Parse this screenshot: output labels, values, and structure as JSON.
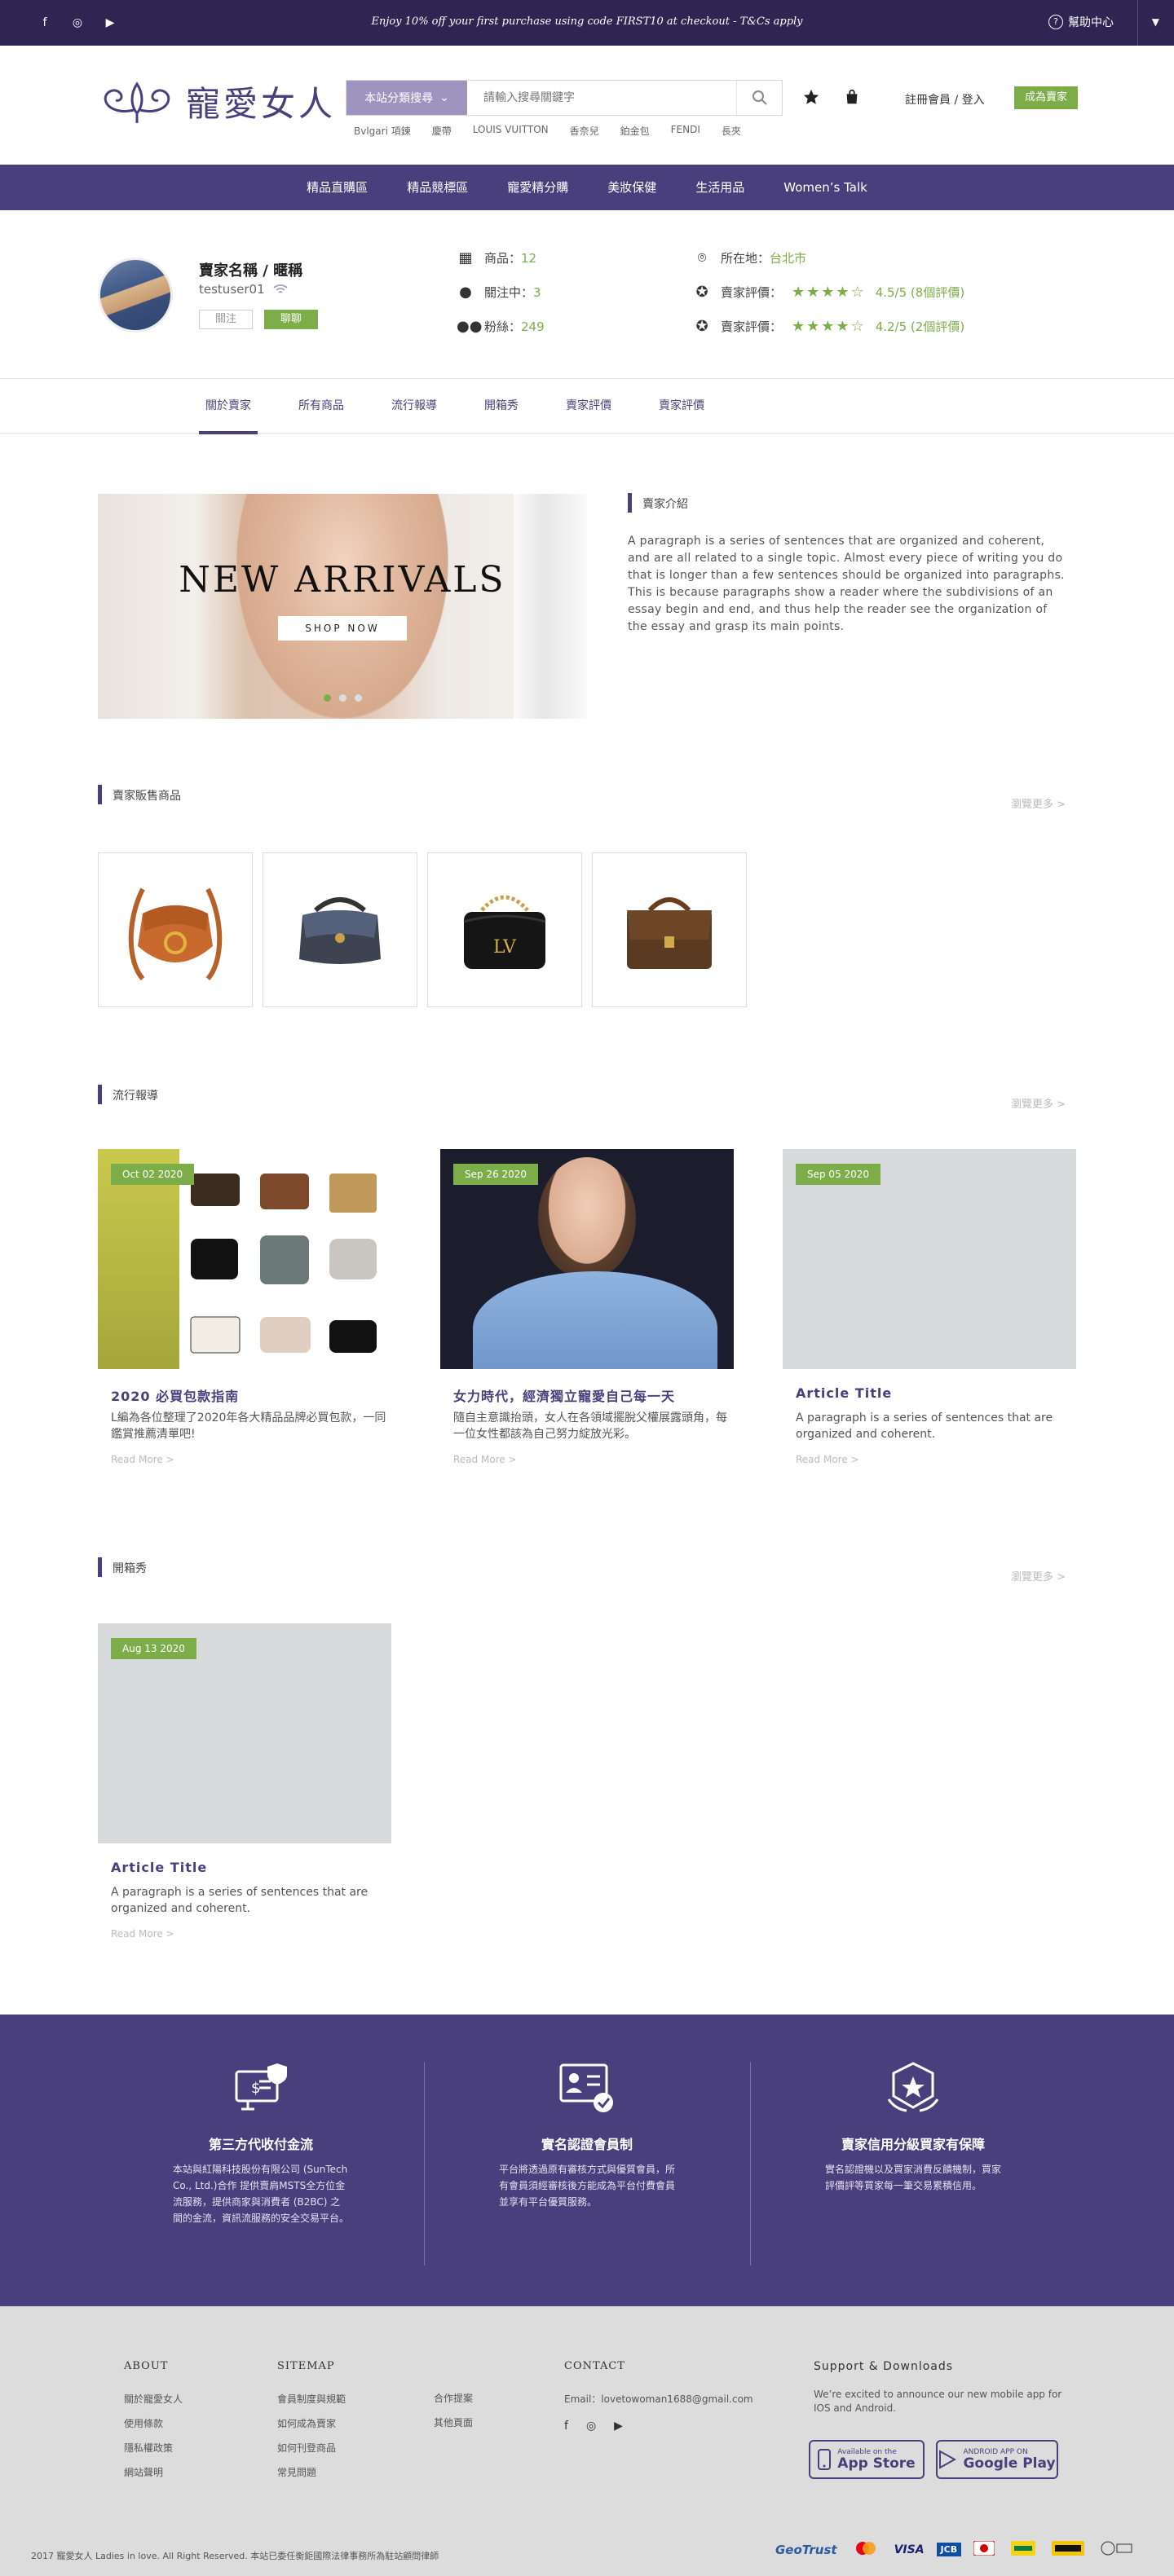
{
  "topbar": {
    "social": [
      "f",
      "◎",
      "▶"
    ],
    "promo": "Enjoy 10% off your first purchase using code FIRST10 at checkout - T&Cs apply",
    "help": "幫助中心"
  },
  "header": {
    "logo_text": "寵愛女人",
    "search_category": "本站分類搜尋",
    "search_placeholder": "請輸入搜尋關鍵字",
    "hot_keywords": [
      "Bvlgari 項鍊",
      "慶帶",
      "LOUIS VUITTON",
      "香奈兒",
      "鉑金包",
      "FENDI",
      "長夾"
    ],
    "login": "註冊會員 / 登入",
    "become_seller": "成為賣家"
  },
  "nav": [
    "精品直購區",
    "精品競標區",
    "寵愛精分購",
    "美妝保健",
    "生活用品",
    "Women’s Talk"
  ],
  "seller": {
    "name": "賣家名稱 / 暱稱",
    "username": "testuser01",
    "follow": "關注",
    "chat": "聊聊",
    "products_label": "商品：",
    "products_value": "12",
    "following_label": "關注中：",
    "following_value": "3",
    "fans_label": "粉絲：",
    "fans_value": "249",
    "location_label": "所在地：",
    "location_value": "台北市",
    "rating1_label": "賣家評價：",
    "rating1_value": "4.5/5 (8個評價)",
    "rating2_label": "賣家評價：",
    "rating2_value": "4.2/5 (2個評價)"
  },
  "tabs": [
    "關於賣家",
    "所有商品",
    "流行報導",
    "開箱秀",
    "賣家評價",
    "賣家評價"
  ],
  "banner": {
    "headline": "NEW ARRIVALS",
    "button": "SHOP NOW"
  },
  "intro": {
    "title": "賣家介紹",
    "text": "A paragraph is a series of sentences that are organized and coherent, and are all related to a single topic. Almost every piece of writing you do that is longer than a few sentences should be organized into paragraphs. This is because paragraphs show a reader where the subdivisions of an essay begin and end, and thus help the reader see the organization of the essay and grasp its main points."
  },
  "products": {
    "title": "賣家販售商品",
    "more": "瀏覽更多 >"
  },
  "news": {
    "title": "流行報導",
    "more": "瀏覽更多 >",
    "articles": [
      {
        "date": "Oct 02 2020",
        "title": "2020 必買包款指南",
        "desc": "L編為各位整理了2020年各大精品品牌必買包款，一同鑑賞推薦清單吧!",
        "more": "Read More >"
      },
      {
        "date": "Sep 26 2020",
        "title": "女力時代，經濟獨立寵愛自己每一天",
        "desc": "隨自主意識抬頭，女人在各領域擺脫父權展露頭角，每一位女性都該為自己努力綻放光彩。",
        "more": "Read More >"
      },
      {
        "date": "Sep 05 2020",
        "title": "Article Title",
        "desc": "A paragraph is a series of sentences that are organized and coherent.",
        "more": "Read More >"
      }
    ]
  },
  "unbox": {
    "title": "開箱秀",
    "more": "瀏覽更多 >",
    "article": {
      "date": "Aug 13 2020",
      "title": "Article Title",
      "desc": "A paragraph is a series of sentences that are organized and coherent.",
      "more": "Read More >"
    }
  },
  "features": [
    {
      "title": "第三方代收付金流",
      "text": "本站與紅陽科技股份有限公司 (SunTech Co., Ltd.)合作\n提供賣肩MSTS全方位金流服務，提供商家與消費者 (B2BC) 之間的金流，資訊流服務的安全交易平台。"
    },
    {
      "title": "實名認證會員制",
      "text": "平台將透過原有審核方式與優質會員，所有會員須經審核後方能成為平台付費會員並享有平台優質服務。"
    },
    {
      "title": "賣家信用分級買家有保障",
      "text": "實名認證機以及買家消費反饋機制，買家評價評等買家每一筆交易累積信用。"
    }
  ],
  "footer": {
    "about_title": "ABOUT",
    "about_links": [
      "關於寵愛女人",
      "使用條款",
      "隱私權政策",
      "網站聲明"
    ],
    "sitemap_title": "SITEMAP",
    "sitemap_links": [
      "會員制度與規範",
      "如何成為賣家",
      "如何刊登商品",
      "常見問題"
    ],
    "sitemap_links2": [
      "合作提案",
      "其他頁面"
    ],
    "contact_title": "CONTACT",
    "email": "Email：lovetowoman1688@gmail.com",
    "support_title": "Support & Downloads",
    "support_text": "We’re excited to announce our new mobile app for IOS and Android.",
    "appstore_small": "Available on the",
    "appstore_big": "App Store",
    "gplay_small": "ANDROID APP ON",
    "gplay_big": "Google Play",
    "copyright": "2017 寵愛女人 Ladies in love. All Right Reserved.   本站已委任衡鉅國際法律事務所為駐站顧問律師",
    "payments": [
      "GeoTrust",
      "VISA",
      "JCB"
    ]
  },
  "colors": {
    "primary": "#4a3f7d",
    "dark": "#2e2552",
    "accent": "#7dad48"
  }
}
